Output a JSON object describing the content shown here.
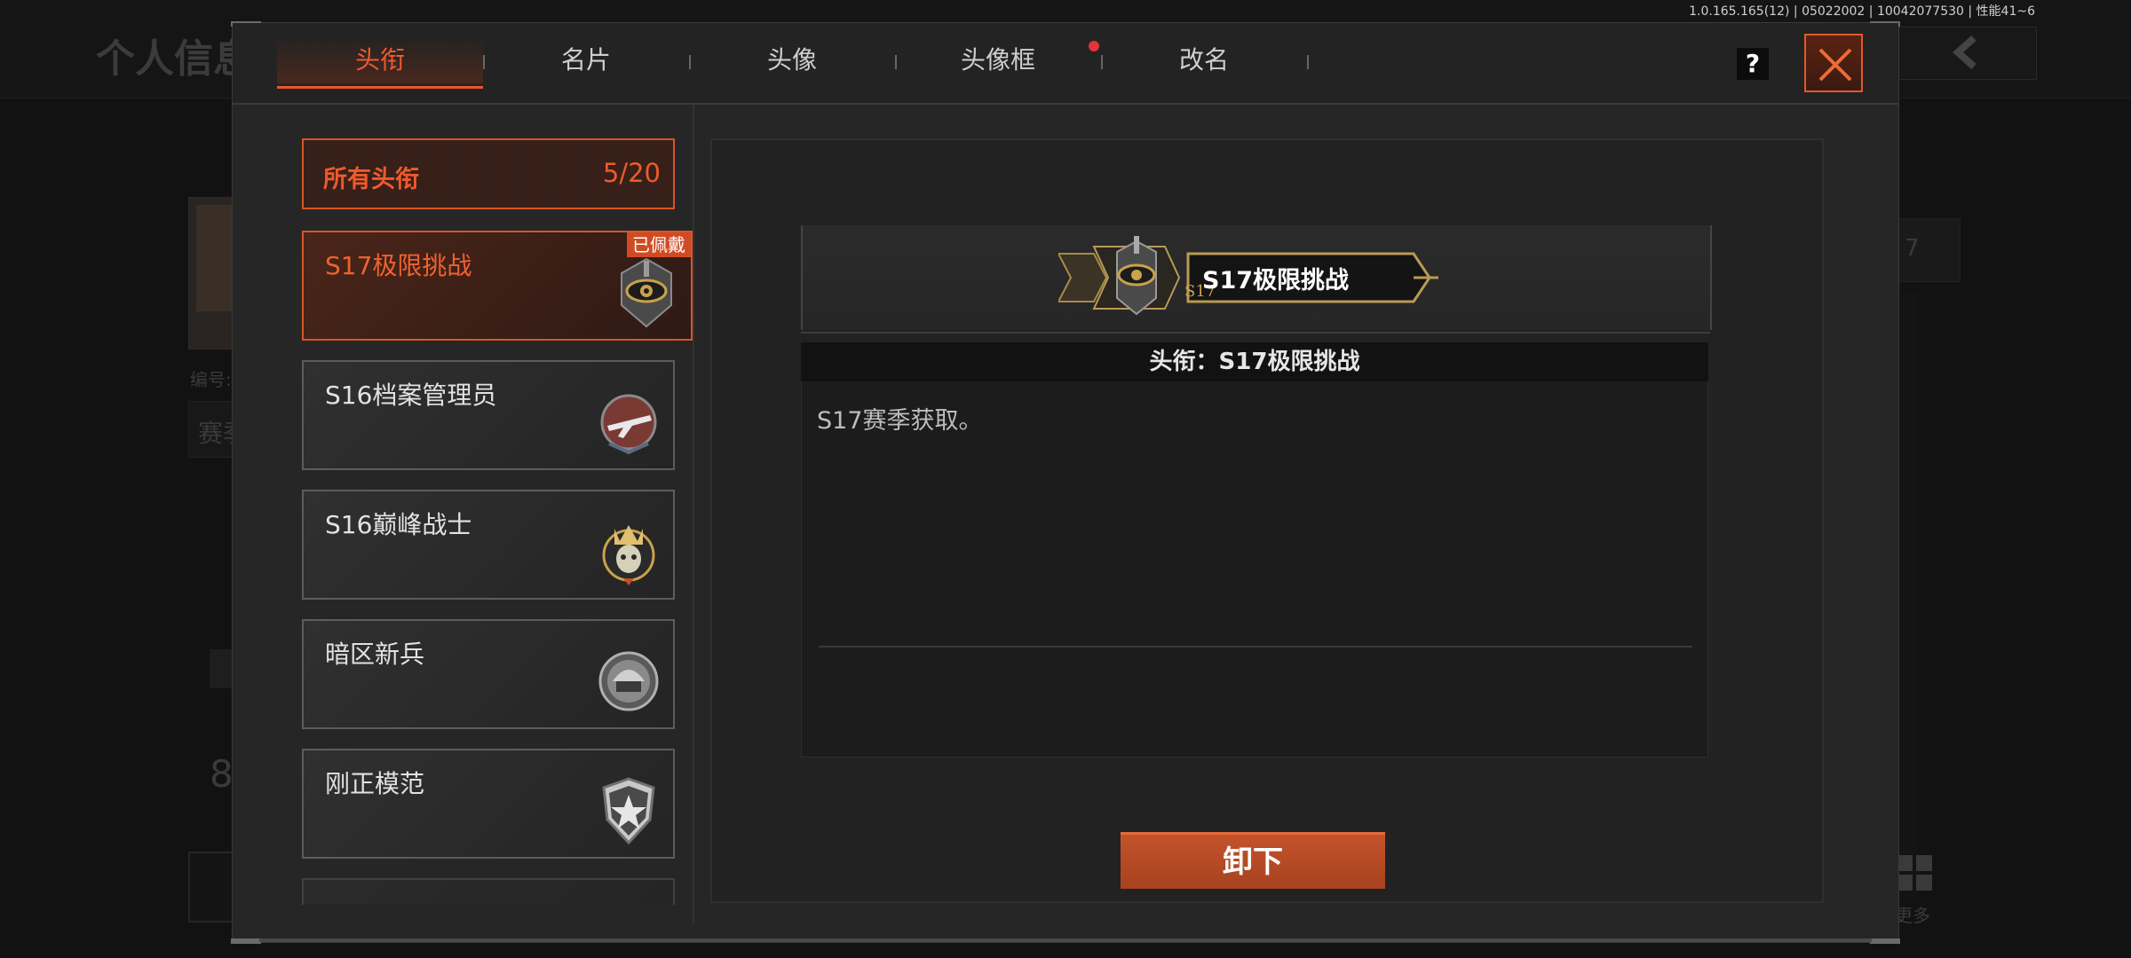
{
  "version_info": "1.0.165.165(12) | 05022002 | 10042077530 | 性能41~6",
  "background": {
    "page_title": "个人信息",
    "label_id": "编号:",
    "label_season": "赛季",
    "number_partial": "8",
    "right_dropdown_partial": "7",
    "more_label": "更多"
  },
  "tabs": [
    {
      "label": "头衔",
      "active": true
    },
    {
      "label": "名片",
      "active": false
    },
    {
      "label": "头像",
      "active": false
    },
    {
      "label": "头像框",
      "active": false,
      "has_notification": true
    },
    {
      "label": "改名",
      "active": false
    }
  ],
  "help_label": "?",
  "list": {
    "all_titles_label": "所有头衔",
    "all_titles_count": "5/20",
    "items": [
      {
        "name": "S17极限挑战",
        "icon": "eye-emblem-icon",
        "selected": true,
        "worn_tag": "已佩戴"
      },
      {
        "name": "S16档案管理员",
        "icon": "airplane-emblem-icon",
        "selected": false
      },
      {
        "name": "S16巅峰战士",
        "icon": "crown-skull-emblem-icon",
        "selected": false
      },
      {
        "name": "暗区新兵",
        "icon": "helmet-emblem-icon",
        "selected": false
      },
      {
        "name": "刚正模范",
        "icon": "star-shield-emblem-icon",
        "selected": false
      }
    ]
  },
  "detail": {
    "banner_text": "S17极限挑战",
    "banner_season_tag": "S17",
    "header": "头衔：S17极限挑战",
    "description": "S17赛季获取。",
    "action_button": "卸下"
  },
  "colors": {
    "accent": "#e9572b",
    "panel": "#262626",
    "notification": "#e0353a"
  }
}
